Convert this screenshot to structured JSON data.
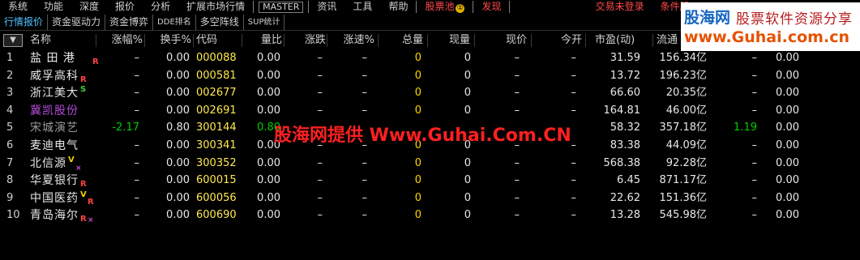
{
  "menu": {
    "items": [
      "系统",
      "功能",
      "深度",
      "报价",
      "分析",
      "扩展市场行情",
      "MASTER",
      "资讯",
      "工具",
      "帮助",
      "股票池",
      "发现",
      "交易未登录",
      "条件股"
    ],
    "pool_badge": "①"
  },
  "tabs": [
    "行情报价",
    "资金驱动力",
    "资金博弈",
    "DDE排名",
    "多空阵线",
    "SUP统计"
  ],
  "logo": {
    "line1a": "股海网",
    "line1b": "股票软件资源分享",
    "line2": "www.Guhai.com.cn"
  },
  "header": {
    "sort_icon": "▼",
    "cols": [
      "名称",
      "涨幅%",
      "换手%",
      "代码",
      "量比",
      "涨跌",
      "涨速%",
      "总量",
      "现量",
      "现价",
      "今开",
      "市盈(动)",
      "流通",
      "",
      ""
    ]
  },
  "rows": [
    {
      "idx": "1",
      "name": "盐 田 港",
      "flags": [
        "R"
      ],
      "zf": "–",
      "hs": "0.00",
      "code": "000088",
      "lb": "0.00",
      "zd": "–",
      "zs": "–",
      "zl": "0",
      "xl": "0",
      "xj": "–",
      "jk": "–",
      "syl": "31.59",
      "lt": "156.34亿",
      "c14": "–",
      "c15": "0.00"
    },
    {
      "idx": "2",
      "name": "威孚高科",
      "flags": [
        "R"
      ],
      "zf": "–",
      "hs": "0.00",
      "code": "000581",
      "lb": "0.00",
      "zd": "–",
      "zs": "–",
      "zl": "0",
      "xl": "0",
      "xj": "–",
      "jk": "–",
      "syl": "13.72",
      "lt": "196.23亿",
      "c14": "–",
      "c15": "0.00"
    },
    {
      "idx": "3",
      "name": "浙江美大",
      "flags": [
        "S"
      ],
      "zf": "–",
      "hs": "0.00",
      "code": "002677",
      "lb": "0.00",
      "zd": "–",
      "zs": "–",
      "zl": "0",
      "xl": "0",
      "xj": "–",
      "jk": "–",
      "syl": "66.60",
      "lt": "20.35亿",
      "c14": "–",
      "c15": "0.00"
    },
    {
      "idx": "4",
      "name": "冀凯股份",
      "flags": [],
      "style": "purple",
      "zf": "–",
      "hs": "0.00",
      "code": "002691",
      "lb": "0.00",
      "zd": "–",
      "zs": "–",
      "zl": "0",
      "xl": "0",
      "xj": "–",
      "jk": "–",
      "syl": "164.81",
      "lt": "46.00亿",
      "c14": "–",
      "c15": "0.00"
    },
    {
      "idx": "5",
      "name": "宋城演艺",
      "flags": [],
      "style": "dim",
      "zf": "-2.17",
      "hs": "0.80",
      "code": "300144",
      "lb": "0.80",
      "zd": "",
      "zs": "",
      "zl": "",
      "xl": "",
      "xj": "",
      "jk": "",
      "syl": "58.32",
      "lt": "357.18亿",
      "c14": "1.19",
      "c15": "0.00"
    },
    {
      "idx": "6",
      "name": "麦迪电气",
      "flags": [],
      "zf": "–",
      "hs": "0.00",
      "code": "300341",
      "lb": "0.00",
      "zd": "–",
      "zs": "–",
      "zl": "0",
      "xl": "0",
      "xj": "–",
      "jk": "–",
      "syl": "83.38",
      "lt": "44.09亿",
      "c14": "–",
      "c15": "0.00"
    },
    {
      "idx": "7",
      "name": "北信源",
      "flags": [
        "V",
        "X"
      ],
      "zf": "–",
      "hs": "0.00",
      "code": "300352",
      "lb": "0.00",
      "zd": "–",
      "zs": "–",
      "zl": "0",
      "xl": "0",
      "xj": "–",
      "jk": "–",
      "syl": "568.38",
      "lt": "92.28亿",
      "c14": "–",
      "c15": "0.00"
    },
    {
      "idx": "8",
      "name": "华夏银行",
      "flags": [
        "R"
      ],
      "zf": "–",
      "hs": "0.00",
      "code": "600015",
      "lb": "0.00",
      "zd": "–",
      "zs": "–",
      "zl": "0",
      "xl": "0",
      "xj": "–",
      "jk": "–",
      "syl": "6.45",
      "lt": "871.17亿",
      "c14": "–",
      "c15": "0.00"
    },
    {
      "idx": "9",
      "name": "中国医药",
      "flags": [
        "V",
        "R"
      ],
      "zf": "–",
      "hs": "0.00",
      "code": "600056",
      "lb": "0.00",
      "zd": "–",
      "zs": "–",
      "zl": "0",
      "xl": "0",
      "xj": "–",
      "jk": "–",
      "syl": "22.62",
      "lt": "151.36亿",
      "c14": "–",
      "c15": "0.00"
    },
    {
      "idx": "10",
      "name": "青岛海尔",
      "flags": [
        "R",
        "X"
      ],
      "zf": "–",
      "hs": "0.00",
      "code": "600690",
      "lb": "0.00",
      "zd": "–",
      "zs": "–",
      "zl": "0",
      "xl": "0",
      "xj": "–",
      "jk": "–",
      "syl": "13.28",
      "lt": "545.98亿",
      "c14": "–",
      "c15": "0.00"
    }
  ],
  "watermark": "股海网提供 Www.Guhai.Com.CN",
  "colors": {
    "code": "#ffe94d",
    "up_flag": "#ff4040",
    "accent_tab": "#4fc3ff",
    "green": "#00d000"
  }
}
